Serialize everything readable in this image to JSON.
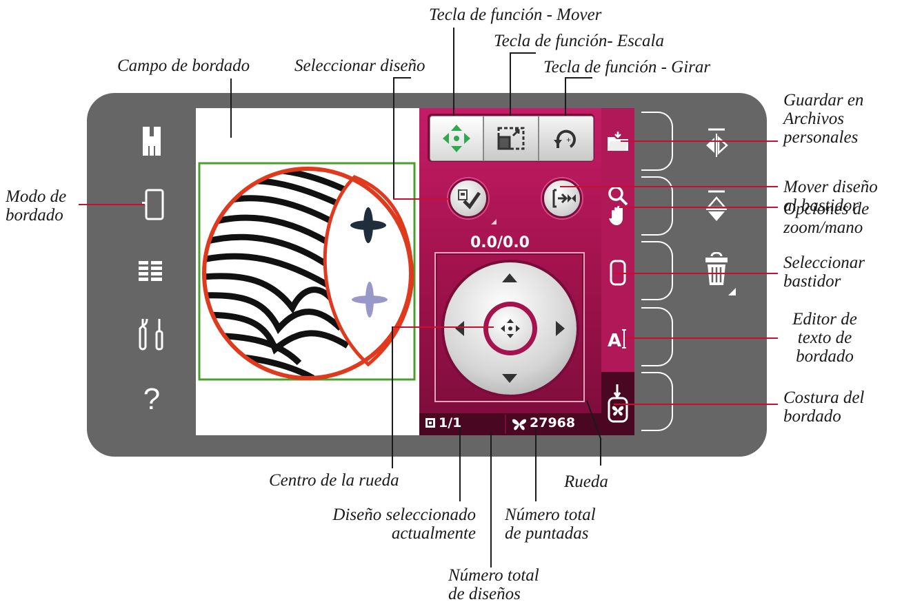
{
  "callouts": {
    "tecla_mover": "Tecla de función - Mover",
    "tecla_escala": "Tecla de función- Escala",
    "tecla_girar": "Tecla de función - Girar",
    "campo_bordado": "Campo de bordado",
    "seleccionar_diseno": "Seleccionar diseño",
    "guardar": [
      "Guardar en",
      "Archivos",
      "personales"
    ],
    "mover_diseno": [
      "Mover diseño",
      "al bastidor"
    ],
    "opciones_zoom": [
      "Opciones de",
      "zoom/mano"
    ],
    "seleccionar_bastidor": [
      "Seleccionar",
      "bastidor"
    ],
    "editor_texto": [
      "Editor de",
      "texto de",
      "bordado"
    ],
    "costura": [
      "Costura del",
      "bordado"
    ],
    "modo_bordado": [
      "Modo de",
      "bordado"
    ],
    "centro_rueda": "Centro de la rueda",
    "rueda": "Rueda",
    "diseno_seleccionado": [
      "Diseño seleccionado",
      "actualmente"
    ],
    "total_puntadas": [
      "Número total",
      "de puntadas"
    ],
    "total_disenos": [
      "Número total",
      "de diseños"
    ]
  },
  "screen": {
    "position_readout": "0.0/0.0",
    "design_counter": "1/1",
    "stitch_count": "27968",
    "help_glyph": "?"
  },
  "colors": {
    "panel": "#b01858",
    "bezel": "#666666",
    "callout_line": "#c8102e",
    "move_icon": "#2fa84f",
    "hoop_outline": "#4aa02c",
    "design_outline": "#e03a1e"
  },
  "icons": {
    "left_bar": [
      "presser-foot-icon",
      "embroidery-mode-icon",
      "stitch-menu-icon",
      "settings-tools-icon",
      "help-icon"
    ],
    "function_keys": [
      "move-arrows-icon",
      "scale-icon",
      "rotate-icon"
    ],
    "right_strip": [
      "folder-save-icon",
      "zoom-hand-icon",
      "hoop-icon",
      "text-editor-icon",
      "embroidery-stitchout-icon"
    ],
    "outer_right": [
      "mirror-horizontal-icon",
      "mirror-vertical-icon",
      "trash-icon"
    ]
  }
}
